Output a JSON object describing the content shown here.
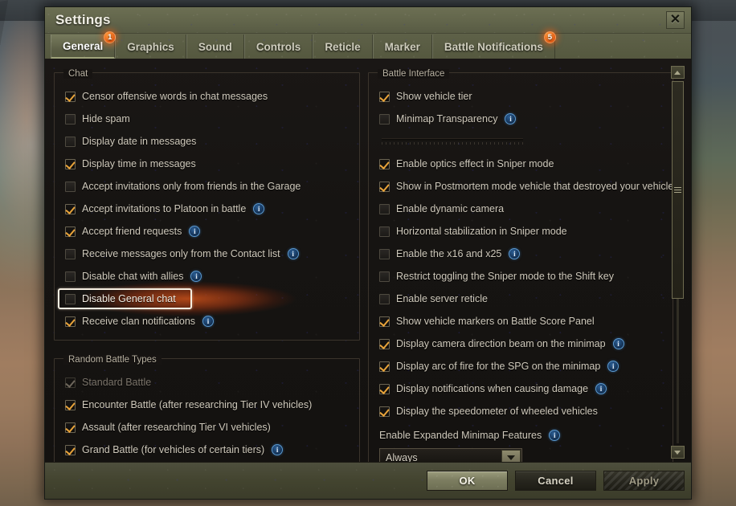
{
  "window": {
    "title": "Settings",
    "close_icon": "close-icon"
  },
  "tabs": [
    {
      "label": "General",
      "active": true,
      "badge": "1"
    },
    {
      "label": "Graphics",
      "active": false,
      "badge": ""
    },
    {
      "label": "Sound",
      "active": false,
      "badge": ""
    },
    {
      "label": "Controls",
      "active": false,
      "badge": ""
    },
    {
      "label": "Reticle",
      "active": false,
      "badge": ""
    },
    {
      "label": "Marker",
      "active": false,
      "badge": ""
    },
    {
      "label": "Battle Notifications",
      "active": false,
      "badge": "5"
    }
  ],
  "left": {
    "chat": {
      "title": "Chat",
      "options": [
        {
          "label": "Censor offensive words in chat messages",
          "checked": true,
          "info": false,
          "disabled": false
        },
        {
          "label": "Hide spam",
          "checked": false,
          "info": false,
          "disabled": false
        },
        {
          "label": "Display date in messages",
          "checked": false,
          "info": false,
          "disabled": false
        },
        {
          "label": "Display time in messages",
          "checked": true,
          "info": false,
          "disabled": false
        },
        {
          "label": "Accept invitations only from friends in the Garage",
          "checked": false,
          "info": false,
          "disabled": false
        },
        {
          "label": "Accept invitations to Platoon in battle",
          "checked": true,
          "info": true,
          "disabled": false
        },
        {
          "label": "Accept friend requests",
          "checked": true,
          "info": true,
          "disabled": false
        },
        {
          "label": "Receive messages only from the Contact list",
          "checked": false,
          "info": true,
          "disabled": false
        },
        {
          "label": "Disable chat with allies",
          "checked": false,
          "info": true,
          "disabled": false
        },
        {
          "label": "Disable General chat",
          "checked": false,
          "info": false,
          "disabled": false,
          "highlighted": true
        },
        {
          "label": "Receive clan notifications",
          "checked": true,
          "info": true,
          "disabled": false
        }
      ]
    },
    "random_battle_types": {
      "title": "Random Battle Types",
      "options": [
        {
          "label": "Standard Battle",
          "checked": true,
          "info": false,
          "disabled": true
        },
        {
          "label": "Encounter Battle (after researching Tier IV vehicles)",
          "checked": true,
          "info": false,
          "disabled": false
        },
        {
          "label": "Assault (after researching Tier VI vehicles)",
          "checked": true,
          "info": false,
          "disabled": false
        },
        {
          "label": "Grand Battle (for vehicles of certain tiers)",
          "checked": true,
          "info": true,
          "disabled": false
        }
      ]
    }
  },
  "right": {
    "battle_interface": {
      "title": "Battle Interface",
      "options_top": [
        {
          "label": "Show vehicle tier",
          "checked": true,
          "info": false,
          "disabled": false
        },
        {
          "label": "Minimap Transparency",
          "checked": false,
          "info": true,
          "disabled": false
        }
      ],
      "slider": {
        "name": "minimap-transparency-slider",
        "value": 0
      },
      "options_mid": [
        {
          "label": "Enable optics effect in Sniper mode",
          "checked": true,
          "info": false,
          "disabled": false
        },
        {
          "label": "Show in Postmortem mode vehicle that destroyed your vehicle",
          "checked": true,
          "info": false,
          "disabled": false
        },
        {
          "label": "Enable dynamic camera",
          "checked": false,
          "info": false,
          "disabled": false
        },
        {
          "label": "Horizontal stabilization in Sniper mode",
          "checked": false,
          "info": false,
          "disabled": false
        },
        {
          "label": "Enable the x16 and x25",
          "checked": false,
          "info": true,
          "disabled": false
        },
        {
          "label": "Restrict toggling the Sniper mode to the Shift key",
          "checked": false,
          "info": false,
          "disabled": false
        },
        {
          "label": "Enable server reticle",
          "checked": false,
          "info": false,
          "disabled": false
        },
        {
          "label": "Show vehicle markers on Battle Score Panel",
          "checked": true,
          "info": false,
          "disabled": false
        },
        {
          "label": "Display camera direction beam on the minimap",
          "checked": true,
          "info": true,
          "disabled": false
        },
        {
          "label": "Display arc of fire for the SPG on the minimap",
          "checked": true,
          "info": true,
          "disabled": false
        },
        {
          "label": "Display notifications when causing damage",
          "checked": true,
          "info": true,
          "disabled": false
        },
        {
          "label": "Display the speedometer of wheeled vehicles",
          "checked": true,
          "info": false,
          "disabled": false
        }
      ],
      "expanded_minimap": {
        "label": "Enable Expanded Minimap Features",
        "info": true,
        "value": "Always",
        "options": [
          "Always"
        ]
      }
    }
  },
  "scrollbar": {
    "up_icon": "chevron-up-icon",
    "down_icon": "chevron-down-icon",
    "thumb_top_pct": 0,
    "thumb_height_pct": 60
  },
  "footer": {
    "ok_label": "OK",
    "cancel_label": "Cancel",
    "apply_label": "Apply",
    "apply_disabled": true
  },
  "colors": {
    "accent_orange": "#e35b14",
    "checkmark": "#e8a33a",
    "info_blue": "#5b9ad1",
    "highlight_border": "#f6efe2",
    "tab_olive": "#62654b"
  }
}
